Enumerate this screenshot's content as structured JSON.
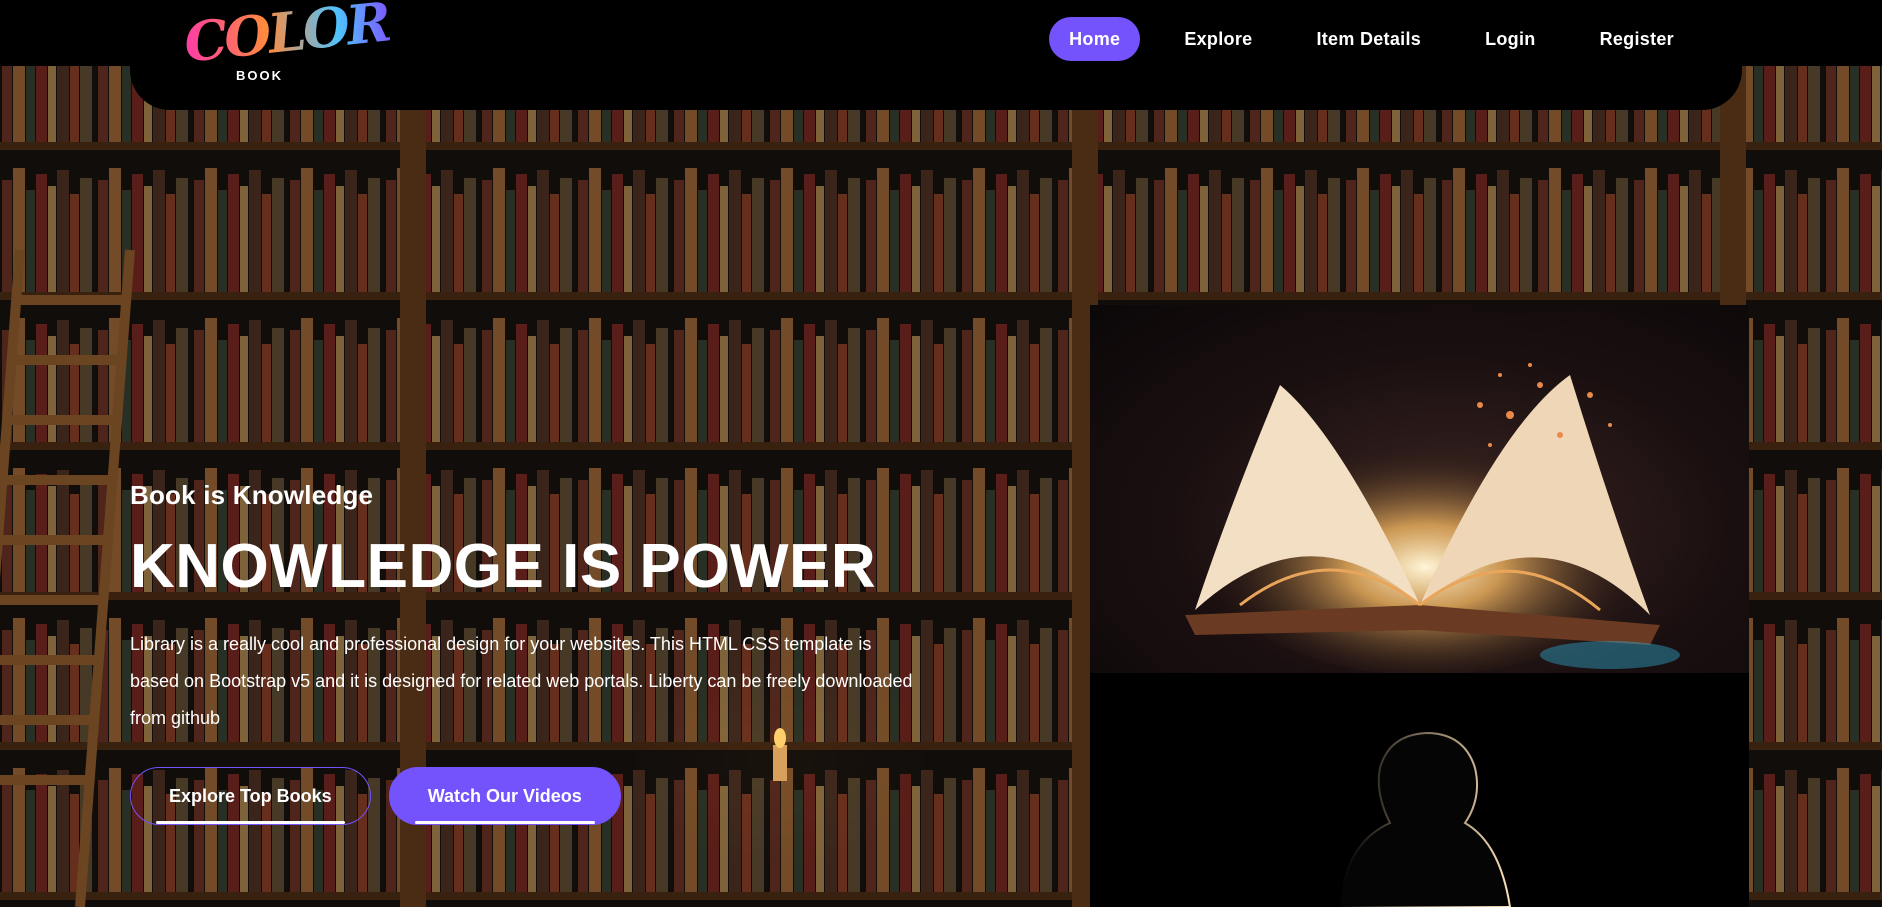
{
  "logo": {
    "mark": "COLOR",
    "sub": "BOOK"
  },
  "nav": {
    "items": [
      {
        "label": "Home",
        "active": true
      },
      {
        "label": "Explore",
        "active": false
      },
      {
        "label": "Item Details",
        "active": false
      },
      {
        "label": "Login",
        "active": false
      },
      {
        "label": "Register",
        "active": false
      }
    ]
  },
  "hero": {
    "subtitle": "Book is Knowledge",
    "title": "KNOWLEDGE IS POWER",
    "description": "Library is a really cool and professional design for your websites. This HTML CSS template is based on Bootstrap v5 and it is designed for related web portals. Liberty can be freely downloaded from github",
    "explore_button": "Explore Top Books",
    "videos_button": "Watch Our Videos"
  },
  "images": {
    "book": "glowing-open-book-image",
    "reader": "reader-silhouette-image"
  },
  "colors": {
    "accent": "#7453fc",
    "background": "#000000"
  }
}
